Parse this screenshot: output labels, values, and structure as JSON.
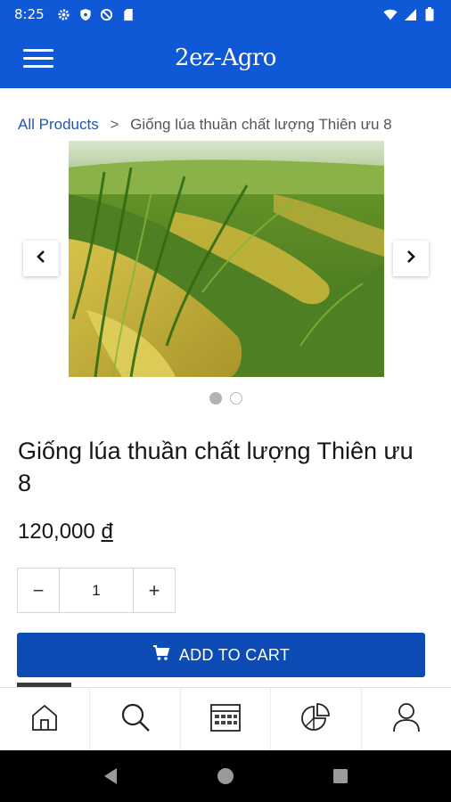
{
  "status_bar": {
    "time": "8:25",
    "icons": [
      "gear-icon",
      "shield-icon",
      "sync-off-icon",
      "sim-card-icon"
    ],
    "right_icons": [
      "wifi-icon",
      "signal-icon",
      "battery-icon"
    ]
  },
  "app_bar": {
    "title": "2ez-Agro",
    "menu_icon": "hamburger-icon",
    "color": "#0f58d6"
  },
  "breadcrumb": {
    "root": "All Products",
    "separator": ">",
    "current": "Giống lúa thuần chất lượng Thiên ưu 8"
  },
  "gallery": {
    "image": "rice-field-photo",
    "prev_icon": "chevron-left-icon",
    "next_icon": "chevron-right-icon",
    "slide_count": 2,
    "active_slide": 1
  },
  "product": {
    "title": "Giống lúa thuần chất lượng Thiên ưu 8",
    "price_amount": "120,000",
    "currency": "đ"
  },
  "quantity": {
    "minus": "−",
    "value": "1",
    "plus": "+"
  },
  "add_to_cart": {
    "label": "ADD TO CART",
    "icon": "cart-icon",
    "color": "#0d4bb5"
  },
  "bottom_nav": {
    "items": [
      "home-icon",
      "search-icon",
      "calendar-icon",
      "pie-chart-icon",
      "user-icon"
    ]
  },
  "system_nav": {
    "items": [
      "back-icon",
      "home-button-icon",
      "recents-icon"
    ]
  }
}
